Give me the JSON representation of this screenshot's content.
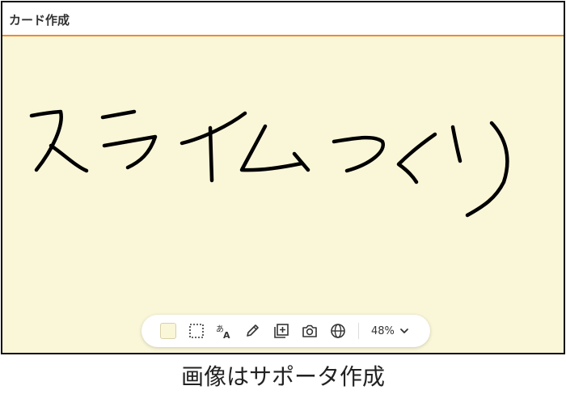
{
  "window": {
    "title": "カード作成"
  },
  "canvas": {
    "background_color": "#faf6d8",
    "handwritten_text": "スライムつくり",
    "accent_color": "#f08a2a"
  },
  "toolbar": {
    "tools": [
      {
        "name": "background-color",
        "icon": "color-swatch-icon"
      },
      {
        "name": "selection",
        "icon": "dotted-select-icon"
      },
      {
        "name": "text",
        "icon": "text-icon"
      },
      {
        "name": "pen",
        "icon": "pen-icon"
      },
      {
        "name": "add-card",
        "icon": "add-card-icon"
      },
      {
        "name": "camera",
        "icon": "camera-icon"
      },
      {
        "name": "web",
        "icon": "globe-icon"
      }
    ],
    "zoom": "48%"
  },
  "caption": "画像はサポータ作成"
}
